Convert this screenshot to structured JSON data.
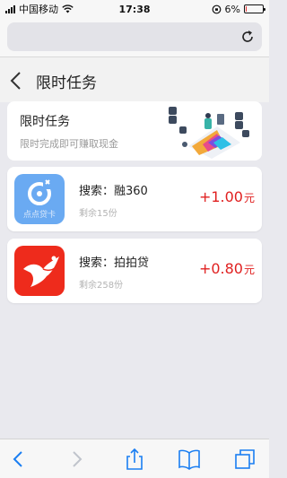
{
  "status_bar": {
    "carrier": "中国移动",
    "time": "17:38",
    "battery_percent": "6%",
    "battery_level": 0.06,
    "colors": {
      "battery_low": "#e52d2d"
    }
  },
  "header": {
    "title": "限时任务",
    "back_icon": "chevron-left-icon"
  },
  "banner": {
    "title": "限时任务",
    "subtitle": "限时完成即可赚取现金"
  },
  "tasks": [
    {
      "name": "搜索：融360",
      "remaining": "剩余15份",
      "reward_amount": "+1.00",
      "reward_unit": "元",
      "icon": "rong360-app-icon",
      "icon_caption": "点点贷卡"
    },
    {
      "name": "搜索：拍拍贷",
      "remaining": "剩余258份",
      "reward_amount": "+0.80",
      "reward_unit": "元",
      "icon": "paipaidai-app-icon"
    }
  ],
  "colors": {
    "reward": "#e02020",
    "toolbar_tint": "#1a7ef2",
    "rong360_bg": "#6aaaf2",
    "paipaidai_bg": "#ee2b1c"
  },
  "toolbar": [
    "back-icon",
    "forward-icon",
    "share-icon",
    "bookmarks-icon",
    "tabs-icon"
  ]
}
